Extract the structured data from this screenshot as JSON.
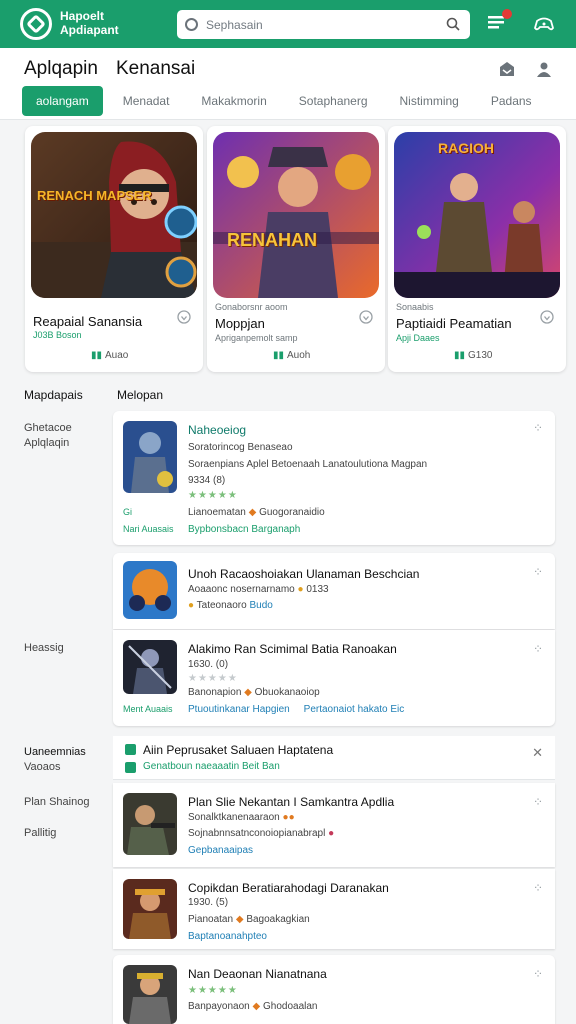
{
  "appbar": {
    "brand_line1": "Hapoelt",
    "brand_line2": "Apdiapant",
    "search_placeholder": "Sephasain",
    "accent": "#1a9e6c"
  },
  "header": {
    "title": "Aplqapin",
    "title2": "Kenansai",
    "tabs": [
      "aolangam",
      "Menadat",
      "Makakmorin",
      "Sotaphanerg",
      "Nistimming",
      "Padans"
    ]
  },
  "featured": [
    {
      "category": "",
      "name": "Reapaial Sanansia",
      "sub": "J03B Boson",
      "meta_label": "Auao",
      "art_title": "RENACH MAPSER"
    },
    {
      "category": "Gonaborsnr aoom",
      "name": "Moppjan",
      "sub": "Apriganpemolt samp",
      "meta_label": "Auoh",
      "art_title": "RENAHAN"
    },
    {
      "category": "Sonaabis",
      "name": "Paptiaidi Peamatian",
      "sub": "Apji Daaes",
      "meta_label": "G130",
      "art_title": "RAGIOH"
    }
  ],
  "side_labels": {
    "col1_header": "Mapdapais",
    "col2_header": "Melopan",
    "group1": [
      "Ghetacoe",
      "Aplqlaqin"
    ],
    "group2": [
      "Heassig"
    ],
    "group3_header": [
      "Uaneemnias",
      "Vaoaos"
    ],
    "group4": [
      "Plan Shainog"
    ],
    "group5": [
      "Pallitig"
    ]
  },
  "rows": [
    {
      "title": "Naheoeiog",
      "line1": "Soratorincog Benaseao",
      "line2": "Soraenpians Aplel Betoenaah Lanatoulutiona Magpan",
      "line3": "9334 (8)",
      "stars": "★★★★★",
      "line4": "Lianoematan",
      "line4b": "Guogoranaidio",
      "line5": "Bypbonsbacn Barganaph",
      "left_note": "Nari Auasais",
      "left_note_top": "Gi"
    },
    {
      "title": "Unoh Racaoshoiakan Ulanaman Beschcian",
      "line1": "Aoaaonc nosernarnamo",
      "line1b": "0133",
      "line2": "Tateonaoro",
      "line2b": "Budo"
    },
    {
      "title": "Alakimo Ran Scimimal Batia Ranoakan",
      "line1": "1630. (0)",
      "stars": "★★★★★",
      "line2": "Banonapion",
      "line2b": "Obuokanaoiop",
      "line3": "Ptuoutinkanar Hapgien",
      "line3b": "Pertaonaiot hakato",
      "line3c": "Eic",
      "left_note": "Ment Auaais"
    }
  ],
  "ribbon": {
    "title": "Aiin Peprusaket Saluaen Haptatena",
    "sub": "Genatboun naeaaatin Beit Ban"
  },
  "rows2": [
    {
      "title": "Plan Slie Nekantan I Samkantra Apdlia",
      "line1": "Sonalktkanenaaraon",
      "line2": "Sojnabnnsatnconoiopianabrapl",
      "line3": "Gepbanaaipas"
    },
    {
      "title": "Copikdan Beratiarahodagi Daranakan",
      "line1": "1930. (5)",
      "line2": "Pianoatan",
      "line2b": "Bagoakagkian",
      "line3": "Baptanoanahpteo"
    },
    {
      "title": "Nan Deaonan Nianatnana",
      "stars": "★★★★★",
      "line1": "Banpayonaon",
      "line1b": "Ghodoaalan"
    }
  ]
}
